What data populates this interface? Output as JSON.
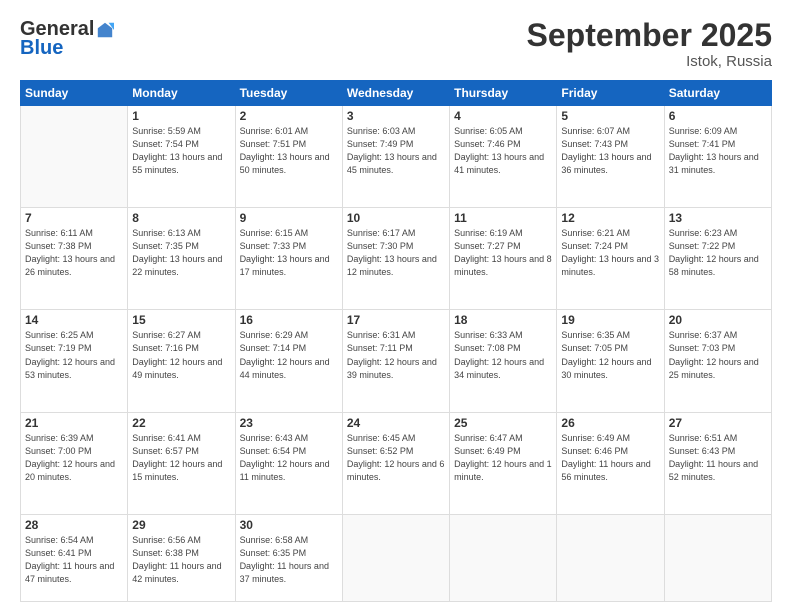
{
  "header": {
    "logo": {
      "general": "General",
      "blue": "Blue"
    },
    "title": "September 2025",
    "location": "Istok, Russia"
  },
  "weekdays": [
    "Sunday",
    "Monday",
    "Tuesday",
    "Wednesday",
    "Thursday",
    "Friday",
    "Saturday"
  ],
  "weeks": [
    [
      {
        "day": null
      },
      {
        "day": 1,
        "sunrise": "Sunrise: 5:59 AM",
        "sunset": "Sunset: 7:54 PM",
        "daylight": "Daylight: 13 hours and 55 minutes."
      },
      {
        "day": 2,
        "sunrise": "Sunrise: 6:01 AM",
        "sunset": "Sunset: 7:51 PM",
        "daylight": "Daylight: 13 hours and 50 minutes."
      },
      {
        "day": 3,
        "sunrise": "Sunrise: 6:03 AM",
        "sunset": "Sunset: 7:49 PM",
        "daylight": "Daylight: 13 hours and 45 minutes."
      },
      {
        "day": 4,
        "sunrise": "Sunrise: 6:05 AM",
        "sunset": "Sunset: 7:46 PM",
        "daylight": "Daylight: 13 hours and 41 minutes."
      },
      {
        "day": 5,
        "sunrise": "Sunrise: 6:07 AM",
        "sunset": "Sunset: 7:43 PM",
        "daylight": "Daylight: 13 hours and 36 minutes."
      },
      {
        "day": 6,
        "sunrise": "Sunrise: 6:09 AM",
        "sunset": "Sunset: 7:41 PM",
        "daylight": "Daylight: 13 hours and 31 minutes."
      }
    ],
    [
      {
        "day": 7,
        "sunrise": "Sunrise: 6:11 AM",
        "sunset": "Sunset: 7:38 PM",
        "daylight": "Daylight: 13 hours and 26 minutes."
      },
      {
        "day": 8,
        "sunrise": "Sunrise: 6:13 AM",
        "sunset": "Sunset: 7:35 PM",
        "daylight": "Daylight: 13 hours and 22 minutes."
      },
      {
        "day": 9,
        "sunrise": "Sunrise: 6:15 AM",
        "sunset": "Sunset: 7:33 PM",
        "daylight": "Daylight: 13 hours and 17 minutes."
      },
      {
        "day": 10,
        "sunrise": "Sunrise: 6:17 AM",
        "sunset": "Sunset: 7:30 PM",
        "daylight": "Daylight: 13 hours and 12 minutes."
      },
      {
        "day": 11,
        "sunrise": "Sunrise: 6:19 AM",
        "sunset": "Sunset: 7:27 PM",
        "daylight": "Daylight: 13 hours and 8 minutes."
      },
      {
        "day": 12,
        "sunrise": "Sunrise: 6:21 AM",
        "sunset": "Sunset: 7:24 PM",
        "daylight": "Daylight: 13 hours and 3 minutes."
      },
      {
        "day": 13,
        "sunrise": "Sunrise: 6:23 AM",
        "sunset": "Sunset: 7:22 PM",
        "daylight": "Daylight: 12 hours and 58 minutes."
      }
    ],
    [
      {
        "day": 14,
        "sunrise": "Sunrise: 6:25 AM",
        "sunset": "Sunset: 7:19 PM",
        "daylight": "Daylight: 12 hours and 53 minutes."
      },
      {
        "day": 15,
        "sunrise": "Sunrise: 6:27 AM",
        "sunset": "Sunset: 7:16 PM",
        "daylight": "Daylight: 12 hours and 49 minutes."
      },
      {
        "day": 16,
        "sunrise": "Sunrise: 6:29 AM",
        "sunset": "Sunset: 7:14 PM",
        "daylight": "Daylight: 12 hours and 44 minutes."
      },
      {
        "day": 17,
        "sunrise": "Sunrise: 6:31 AM",
        "sunset": "Sunset: 7:11 PM",
        "daylight": "Daylight: 12 hours and 39 minutes."
      },
      {
        "day": 18,
        "sunrise": "Sunrise: 6:33 AM",
        "sunset": "Sunset: 7:08 PM",
        "daylight": "Daylight: 12 hours and 34 minutes."
      },
      {
        "day": 19,
        "sunrise": "Sunrise: 6:35 AM",
        "sunset": "Sunset: 7:05 PM",
        "daylight": "Daylight: 12 hours and 30 minutes."
      },
      {
        "day": 20,
        "sunrise": "Sunrise: 6:37 AM",
        "sunset": "Sunset: 7:03 PM",
        "daylight": "Daylight: 12 hours and 25 minutes."
      }
    ],
    [
      {
        "day": 21,
        "sunrise": "Sunrise: 6:39 AM",
        "sunset": "Sunset: 7:00 PM",
        "daylight": "Daylight: 12 hours and 20 minutes."
      },
      {
        "day": 22,
        "sunrise": "Sunrise: 6:41 AM",
        "sunset": "Sunset: 6:57 PM",
        "daylight": "Daylight: 12 hours and 15 minutes."
      },
      {
        "day": 23,
        "sunrise": "Sunrise: 6:43 AM",
        "sunset": "Sunset: 6:54 PM",
        "daylight": "Daylight: 12 hours and 11 minutes."
      },
      {
        "day": 24,
        "sunrise": "Sunrise: 6:45 AM",
        "sunset": "Sunset: 6:52 PM",
        "daylight": "Daylight: 12 hours and 6 minutes."
      },
      {
        "day": 25,
        "sunrise": "Sunrise: 6:47 AM",
        "sunset": "Sunset: 6:49 PM",
        "daylight": "Daylight: 12 hours and 1 minute."
      },
      {
        "day": 26,
        "sunrise": "Sunrise: 6:49 AM",
        "sunset": "Sunset: 6:46 PM",
        "daylight": "Daylight: 11 hours and 56 minutes."
      },
      {
        "day": 27,
        "sunrise": "Sunrise: 6:51 AM",
        "sunset": "Sunset: 6:43 PM",
        "daylight": "Daylight: 11 hours and 52 minutes."
      }
    ],
    [
      {
        "day": 28,
        "sunrise": "Sunrise: 6:54 AM",
        "sunset": "Sunset: 6:41 PM",
        "daylight": "Daylight: 11 hours and 47 minutes."
      },
      {
        "day": 29,
        "sunrise": "Sunrise: 6:56 AM",
        "sunset": "Sunset: 6:38 PM",
        "daylight": "Daylight: 11 hours and 42 minutes."
      },
      {
        "day": 30,
        "sunrise": "Sunrise: 6:58 AM",
        "sunset": "Sunset: 6:35 PM",
        "daylight": "Daylight: 11 hours and 37 minutes."
      },
      {
        "day": null
      },
      {
        "day": null
      },
      {
        "day": null
      },
      {
        "day": null
      }
    ]
  ]
}
